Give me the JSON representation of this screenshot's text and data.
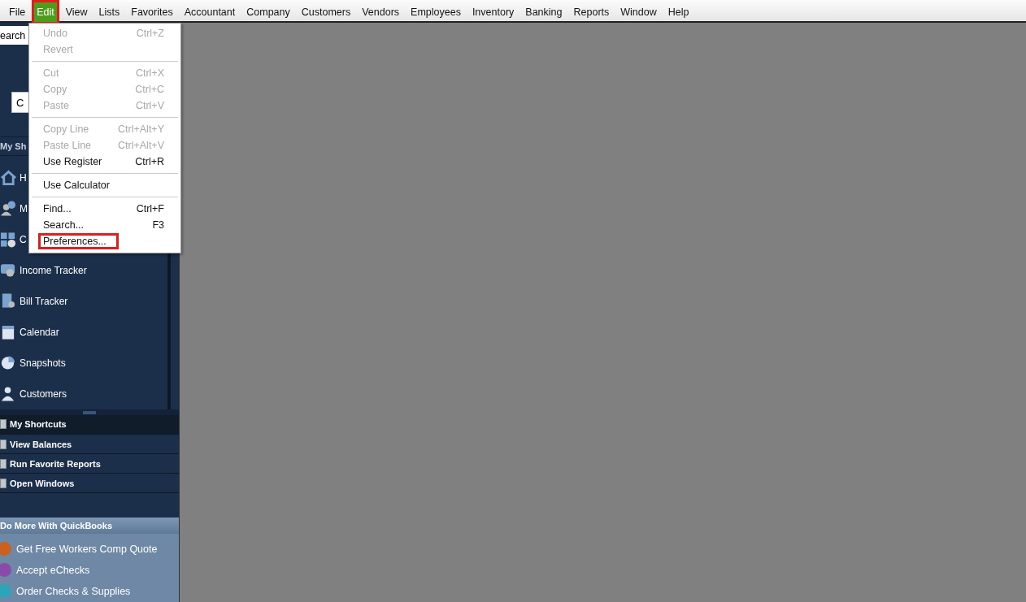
{
  "menubar": [
    {
      "label": "File",
      "selected": false,
      "highlighted": false
    },
    {
      "label": "Edit",
      "selected": true,
      "highlighted": true
    },
    {
      "label": "View",
      "selected": false,
      "highlighted": false
    },
    {
      "label": "Lists",
      "selected": false,
      "highlighted": false
    },
    {
      "label": "Favorites",
      "selected": false,
      "highlighted": false
    },
    {
      "label": "Accountant",
      "selected": false,
      "highlighted": false
    },
    {
      "label": "Company",
      "selected": false,
      "highlighted": false
    },
    {
      "label": "Customers",
      "selected": false,
      "highlighted": false
    },
    {
      "label": "Vendors",
      "selected": false,
      "highlighted": false
    },
    {
      "label": "Employees",
      "selected": false,
      "highlighted": false
    },
    {
      "label": "Inventory",
      "selected": false,
      "highlighted": false
    },
    {
      "label": "Banking",
      "selected": false,
      "highlighted": false
    },
    {
      "label": "Reports",
      "selected": false,
      "highlighted": false
    },
    {
      "label": "Window",
      "selected": false,
      "highlighted": false
    },
    {
      "label": "Help",
      "selected": false,
      "highlighted": false
    }
  ],
  "edit_menu": [
    {
      "kind": "item",
      "label": "Undo",
      "shortcut": "Ctrl+Z",
      "disabled": true,
      "highlighted": false
    },
    {
      "kind": "item",
      "label": "Revert",
      "disabled": true,
      "highlighted": false
    },
    {
      "kind": "separator"
    },
    {
      "kind": "item",
      "label": "Cut",
      "shortcut": "Ctrl+X",
      "disabled": true,
      "highlighted": false
    },
    {
      "kind": "item",
      "label": "Copy",
      "shortcut": "Ctrl+C",
      "disabled": true,
      "highlighted": false
    },
    {
      "kind": "item",
      "label": "Paste",
      "shortcut": "Ctrl+V",
      "disabled": true,
      "highlighted": false
    },
    {
      "kind": "separator"
    },
    {
      "kind": "item",
      "label": "Copy Line",
      "shortcut": "Ctrl+Alt+Y",
      "disabled": true,
      "highlighted": false
    },
    {
      "kind": "item",
      "label": "Paste Line",
      "shortcut": "Ctrl+Alt+V",
      "disabled": true,
      "highlighted": false
    },
    {
      "kind": "item",
      "label": "Use Register",
      "shortcut": "Ctrl+R",
      "disabled": false,
      "highlighted": false
    },
    {
      "kind": "separator"
    },
    {
      "kind": "item",
      "label": "Use Calculator",
      "disabled": false,
      "highlighted": false
    },
    {
      "kind": "separator"
    },
    {
      "kind": "item",
      "label": "Find...",
      "shortcut": "Ctrl+F",
      "disabled": false,
      "highlighted": false
    },
    {
      "kind": "item",
      "label": "Search...",
      "shortcut": "F3",
      "disabled": false,
      "highlighted": false
    },
    {
      "kind": "item",
      "label": "Preferences...",
      "disabled": false,
      "highlighted": true
    }
  ],
  "sidebar": {
    "search": {
      "value": "earch"
    },
    "button_letter": "C",
    "section_title": "My Sh",
    "nav_items": [
      {
        "label": "H"
      },
      {
        "label": "M"
      },
      {
        "label": "C"
      },
      {
        "label": "Income Tracker"
      },
      {
        "label": "Bill Tracker"
      },
      {
        "label": "Calendar"
      },
      {
        "label": "Snapshots"
      },
      {
        "label": "Customers"
      }
    ],
    "tabs": [
      {
        "label": "My Shortcuts",
        "selected": true
      },
      {
        "label": "View Balances",
        "selected": false
      },
      {
        "label": "Run Favorite Reports",
        "selected": false
      },
      {
        "label": "Open Windows",
        "selected": false
      }
    ],
    "promo": {
      "title": "Do More With QuickBooks",
      "items": [
        {
          "label": "Get Free Workers Comp Quote",
          "color": "#c8621e"
        },
        {
          "label": "Accept eChecks",
          "color": "#8a4aa8"
        },
        {
          "label": "Order Checks & Supplies",
          "color": "#2aa6b8"
        }
      ]
    }
  }
}
